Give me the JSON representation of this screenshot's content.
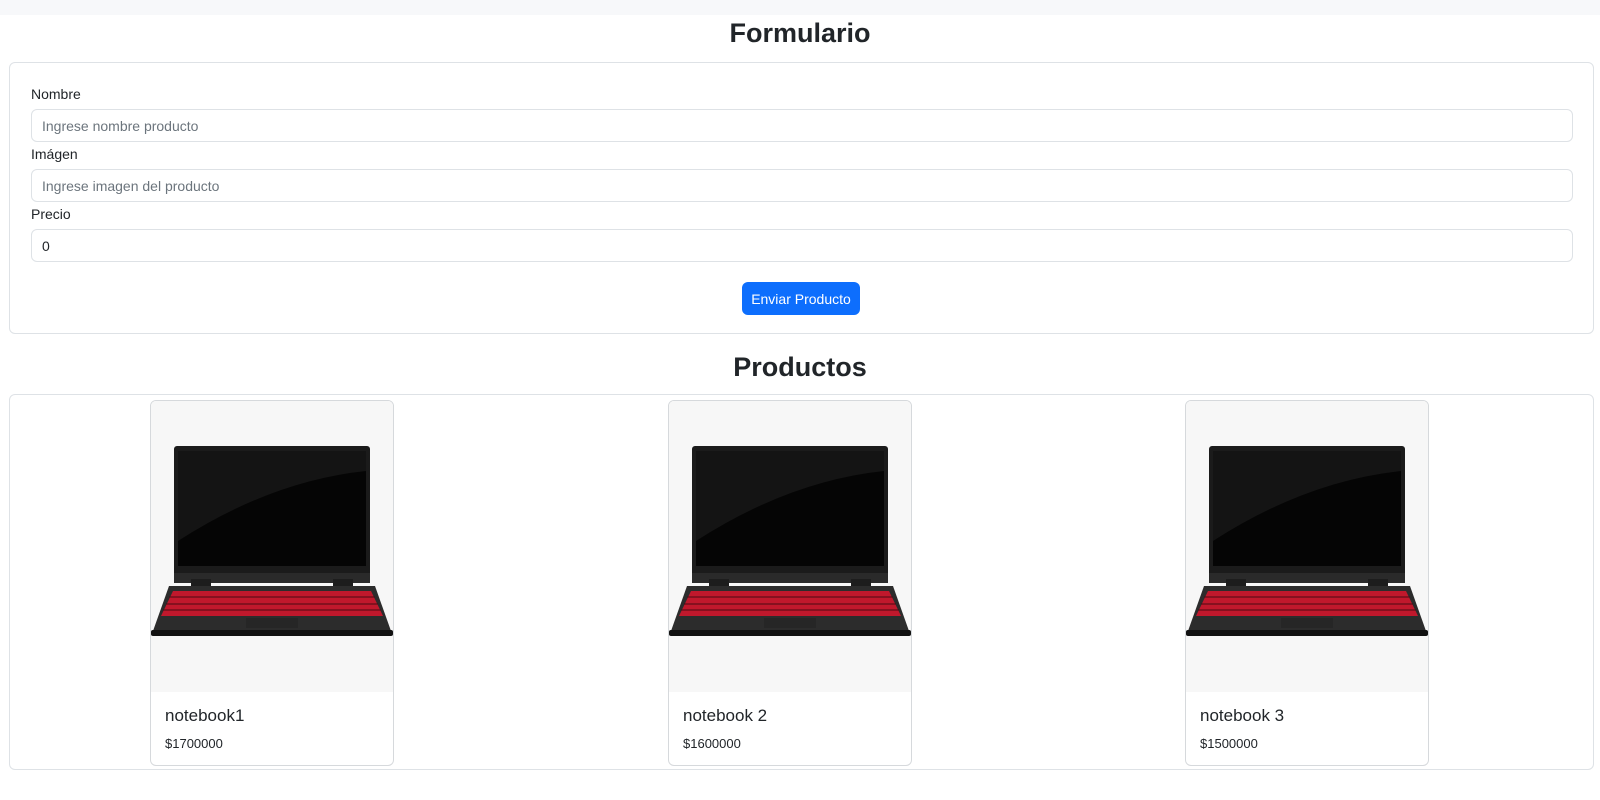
{
  "form": {
    "title": "Formulario",
    "nombre_label": "Nombre",
    "nombre_placeholder": "Ingrese nombre producto",
    "imagen_label": "Imágen",
    "imagen_placeholder": "Ingrese imagen del producto",
    "precio_label": "Precio",
    "precio_value": "0",
    "submit_label": "Enviar Producto"
  },
  "products": {
    "title": "Productos",
    "items": [
      {
        "name": "notebook1",
        "price": "$1700000",
        "image_icon": "laptop-icon"
      },
      {
        "name": "notebook 2",
        "price": "$1600000",
        "image_icon": "laptop-icon"
      },
      {
        "name": "notebook 3",
        "price": "$1500000",
        "image_icon": "laptop-icon"
      }
    ]
  },
  "colors": {
    "primary": "#0d6efd",
    "text": "#212529",
    "border": "#dee2e6",
    "keyboard": "#c0182c"
  }
}
